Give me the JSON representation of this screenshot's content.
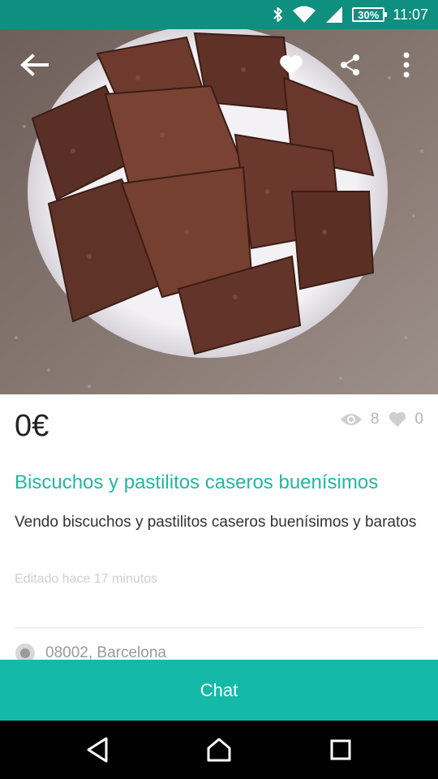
{
  "status_bar": {
    "time": "11:07",
    "battery": "30%",
    "icons": [
      "bluetooth-icon",
      "wifi-icon",
      "signal-icon",
      "battery-icon"
    ]
  },
  "toolbar": {
    "icons": [
      "back-arrow-icon",
      "heart-icon",
      "share-icon",
      "more-vert-icon"
    ]
  },
  "listing": {
    "price": "0€",
    "views": "8",
    "likes": "0",
    "title": "Biscuchos y pastilitos caseros buenísimos",
    "description": "Vendo biscuchos y pastilitos caseros buenísimos y baratos",
    "edited": "Editado hace 17 minutos",
    "location": "08002, Barcelona"
  },
  "actions": {
    "chat_label": "Chat"
  },
  "colors": {
    "status_bar": "#0e8f7f",
    "accent": "#21b7a3",
    "chat_button": "#14b9a8"
  },
  "nav_bar": {
    "icons": [
      "back-triangle-icon",
      "home-icon",
      "recents-square-icon"
    ]
  }
}
